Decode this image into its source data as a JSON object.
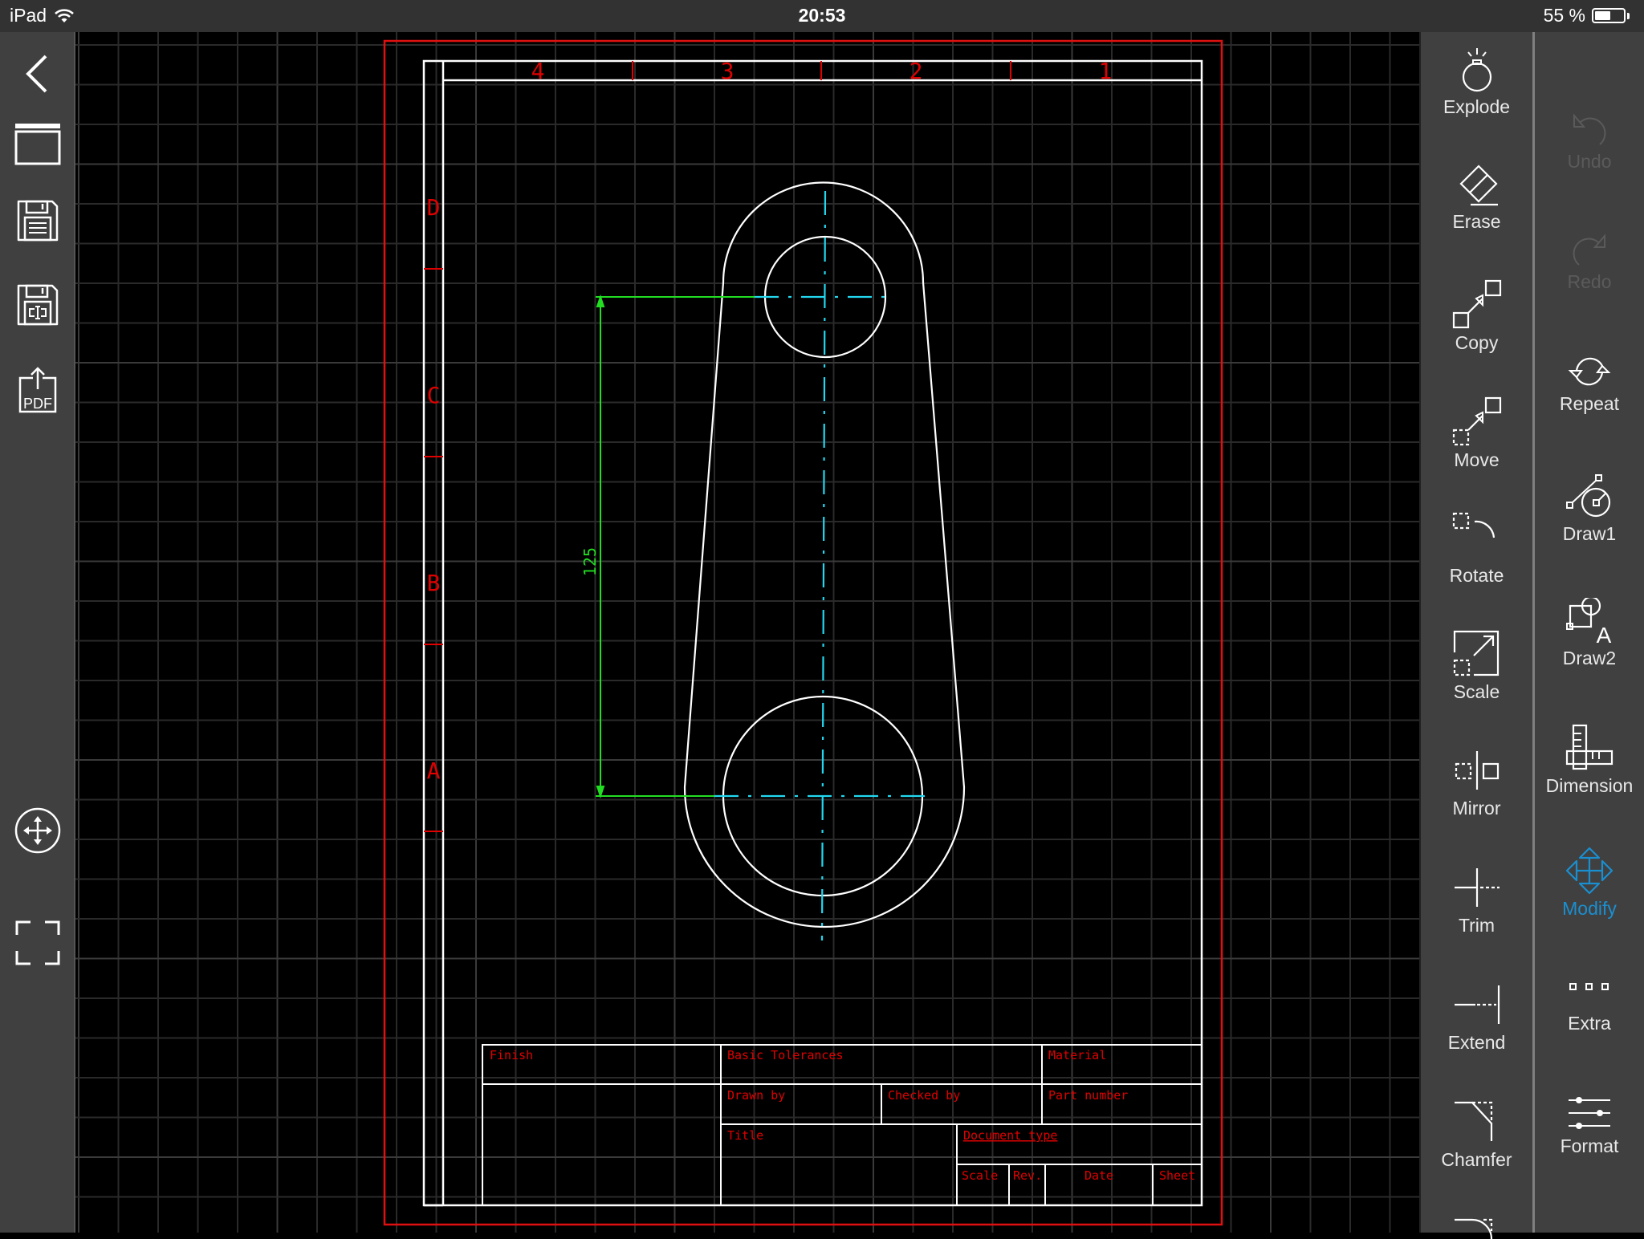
{
  "status_bar": {
    "device": "iPad",
    "time": "20:53",
    "battery_text": "55 %",
    "battery_level": 0.55
  },
  "left_toolbar": {
    "items": [
      {
        "name": "back",
        "icon": "chevron-left-icon"
      },
      {
        "name": "new-drawing",
        "icon": "window-icon"
      },
      {
        "name": "save",
        "icon": "floppy-disk-icon"
      },
      {
        "name": "save-as",
        "icon": "floppy-disk-rename-icon"
      },
      {
        "name": "export-pdf",
        "icon": "pdf-export-icon",
        "label": "PDF"
      },
      {
        "name": "pan",
        "icon": "pan-arrows-icon"
      },
      {
        "name": "zoom-extents",
        "icon": "fullscreen-corners-icon"
      }
    ]
  },
  "toolbar_edit": {
    "items": [
      {
        "label": "Explode",
        "icon": "bomb-icon"
      },
      {
        "label": "Erase",
        "icon": "eraser-icon"
      },
      {
        "label": "Copy",
        "icon": "copy-icon"
      },
      {
        "label": "Move",
        "icon": "move-icon"
      },
      {
        "label": "Rotate",
        "icon": "rotate-icon"
      },
      {
        "label": "Scale",
        "icon": "scale-icon"
      },
      {
        "label": "Mirror",
        "icon": "mirror-icon"
      },
      {
        "label": "Trim",
        "icon": "trim-icon"
      },
      {
        "label": "Extend",
        "icon": "extend-icon"
      },
      {
        "label": "Chamfer",
        "icon": "chamfer-icon"
      },
      {
        "label": "",
        "icon": "fillet-icon"
      }
    ]
  },
  "toolbar_main": {
    "items": [
      {
        "label": "Undo",
        "icon": "undo-icon",
        "enabled": false
      },
      {
        "label": "Redo",
        "icon": "redo-icon",
        "enabled": false
      },
      {
        "label": "Repeat",
        "icon": "repeat-icon",
        "enabled": true
      },
      {
        "label": "Draw1",
        "icon": "draw1-icon",
        "enabled": true
      },
      {
        "label": "Draw2",
        "icon": "draw2-icon",
        "enabled": true
      },
      {
        "label": "Dimension",
        "icon": "dimension-icon",
        "enabled": true
      },
      {
        "label": "Modify",
        "icon": "modify-icon",
        "enabled": true,
        "active": true
      },
      {
        "label": "Extra",
        "icon": "more-dots-icon",
        "enabled": true
      },
      {
        "label": "Format",
        "icon": "sliders-icon",
        "enabled": true
      }
    ],
    "active_color": "#1a8fd0"
  },
  "drawing": {
    "colors": {
      "sheet_border": "#e01010",
      "frame": "#ffffff",
      "zone_text": "#e00000",
      "geometry": "#ffffff",
      "centerline": "#22d8f0",
      "dimension": "#22dd22",
      "grid_minor": "#2a2a2a",
      "grid_major": "#3a3a3a"
    },
    "column_zones": [
      "4",
      "3",
      "2",
      "1"
    ],
    "row_zones": [
      "D",
      "C",
      "B",
      "A"
    ],
    "dimension_value": "125",
    "title_block": {
      "finish": "Finish",
      "basic_tolerances": "Basic Tolerances",
      "material": "Material",
      "drawn_by": "Drawn by",
      "checked_by": "Checked by",
      "part_number": "Part number",
      "title": "Title",
      "document_type": "Document type",
      "scale": "Scale",
      "rev": "Rev.",
      "date": "Date",
      "sheet": "Sheet"
    }
  }
}
